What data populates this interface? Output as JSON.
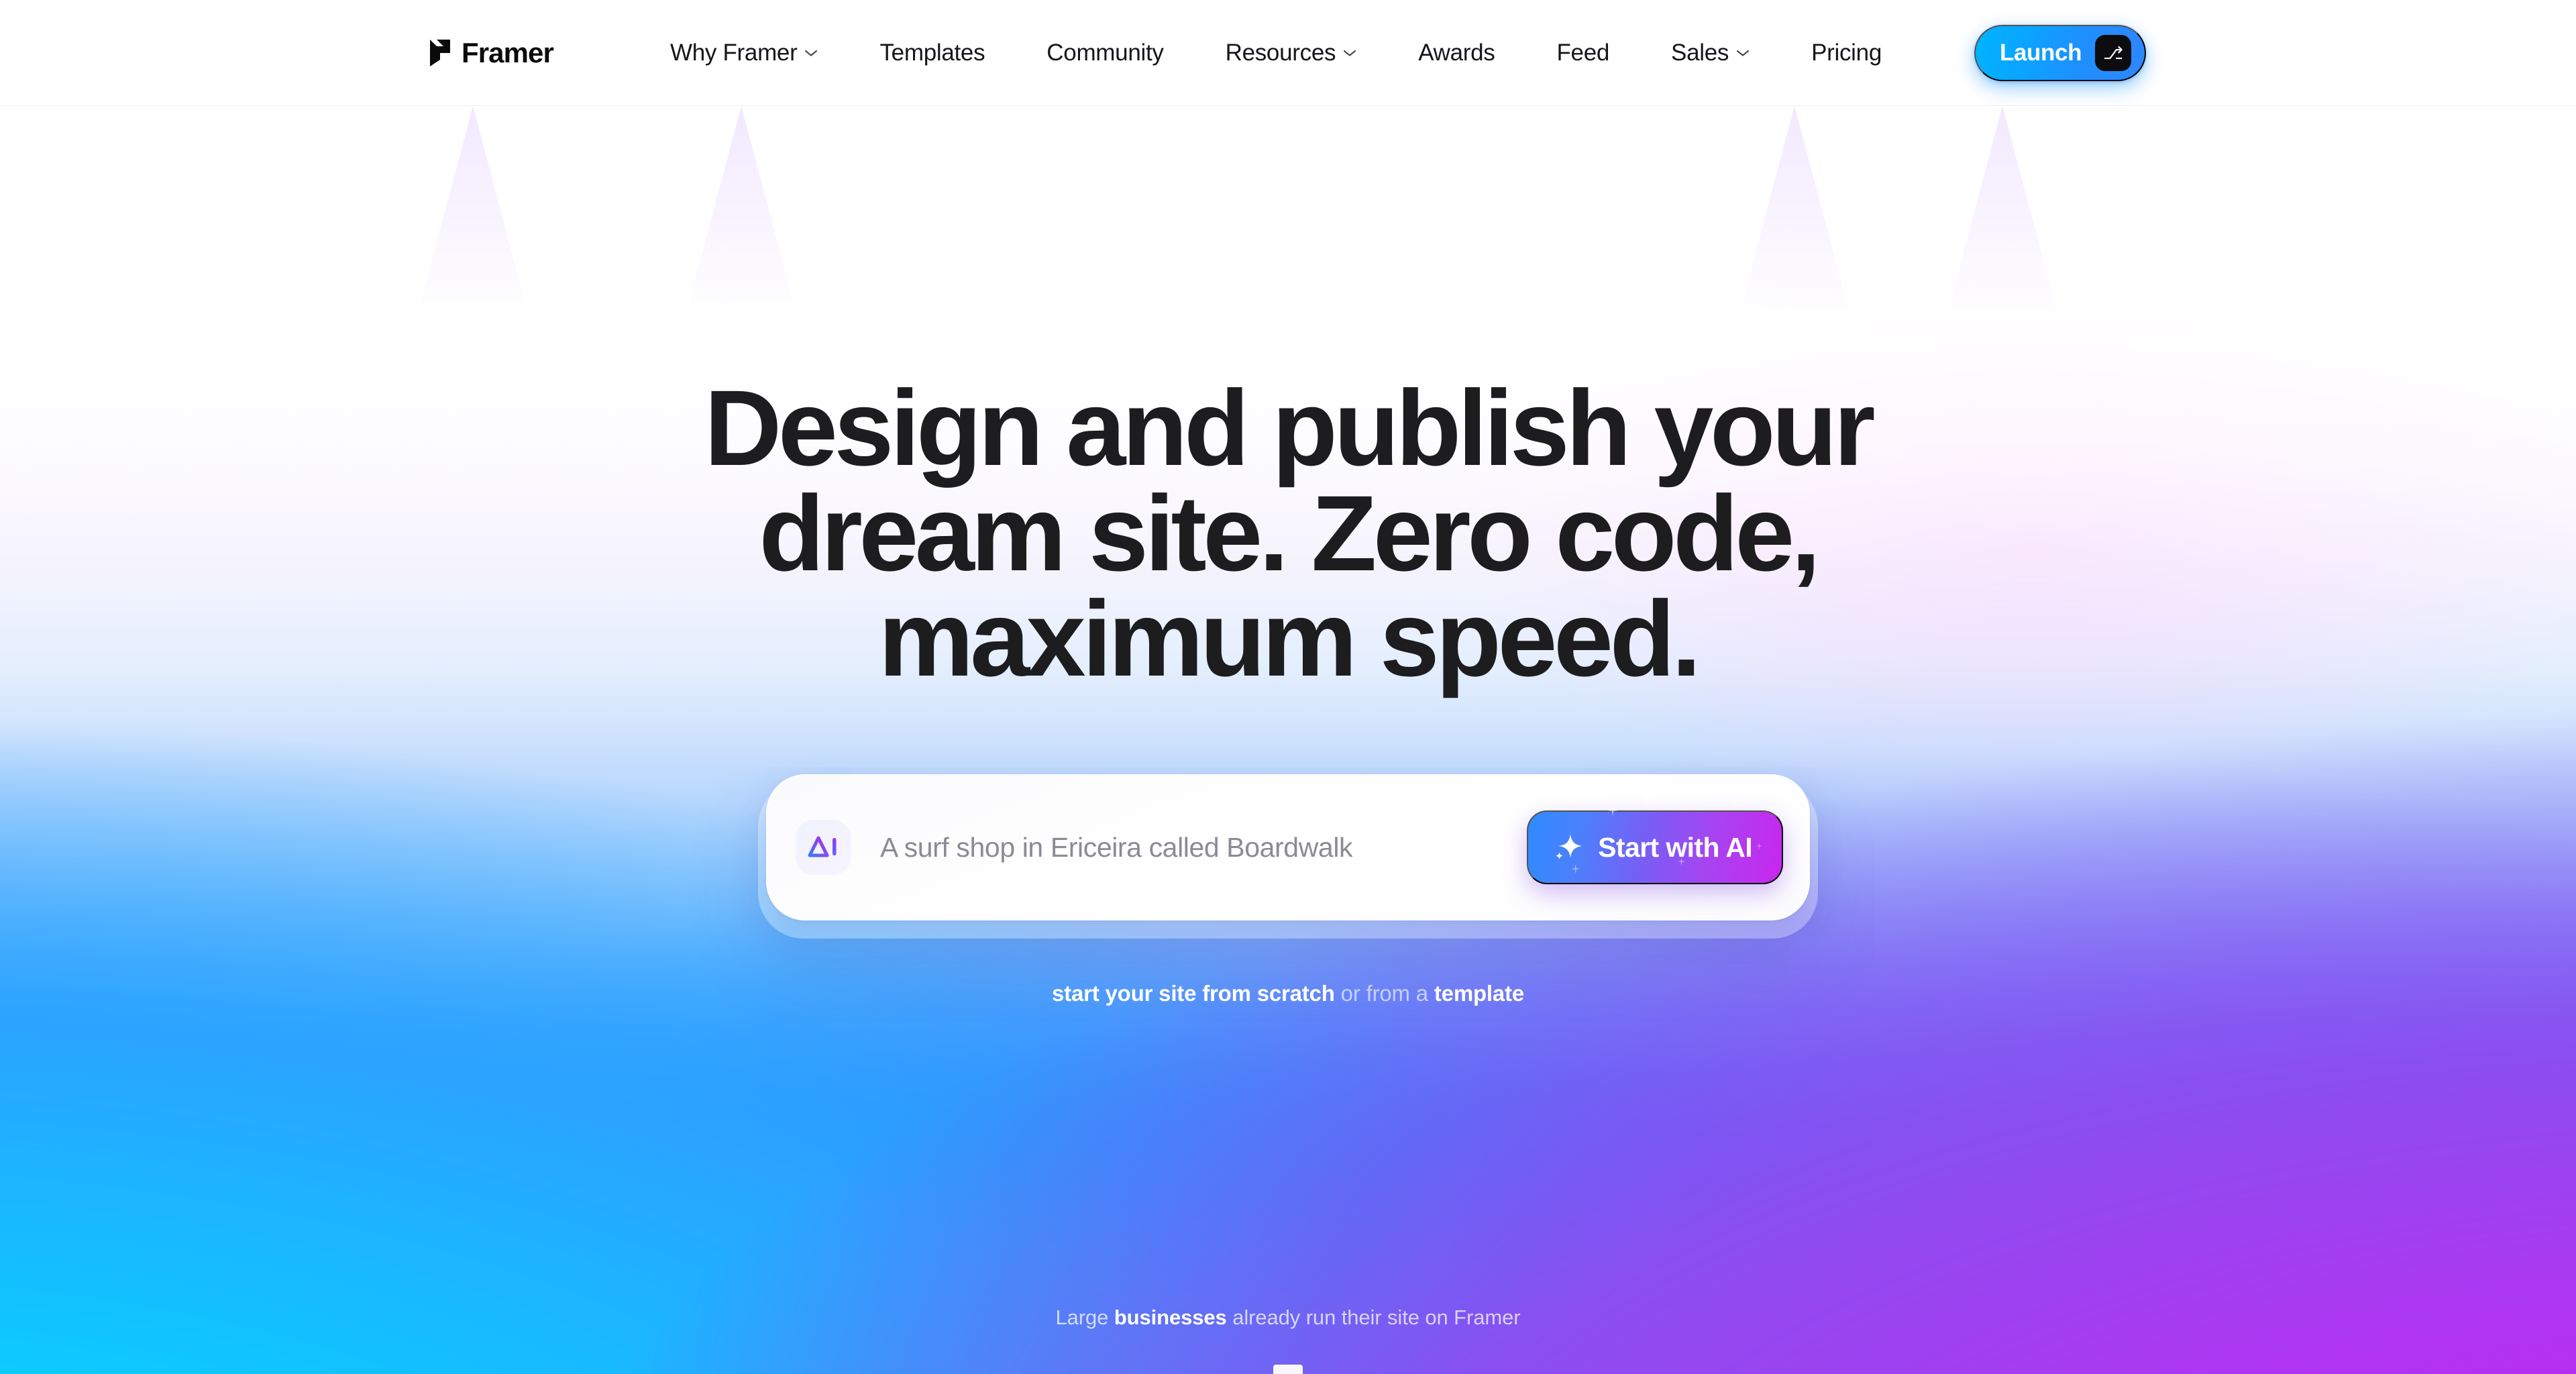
{
  "brand": {
    "name": "Framer",
    "logo_icon": "framer-logo-icon"
  },
  "nav": {
    "items": [
      {
        "label": "Why Framer",
        "has_dropdown": true,
        "icon": "chevron-down-icon"
      },
      {
        "label": "Templates",
        "has_dropdown": false,
        "icon": ""
      },
      {
        "label": "Community",
        "has_dropdown": false,
        "icon": ""
      },
      {
        "label": "Resources",
        "has_dropdown": true,
        "icon": "chevron-down-icon"
      },
      {
        "label": "Awards",
        "has_dropdown": false,
        "icon": ""
      },
      {
        "label": "Feed",
        "has_dropdown": false,
        "icon": ""
      },
      {
        "label": "Sales",
        "has_dropdown": true,
        "icon": "chevron-down-icon"
      },
      {
        "label": "Pricing",
        "has_dropdown": false,
        "icon": ""
      }
    ],
    "launch": {
      "label": "Launch",
      "shortcut_glyph": "⎇",
      "bg_color": "#00b4ff"
    }
  },
  "hero": {
    "headline_lines": [
      "Design and publish your",
      "dream site. Zero code,",
      "maximum speed."
    ],
    "prompt": {
      "ai_icon": "ai-triangle-icon",
      "placeholder": "A surf shop in Ericeira called Boardwalk",
      "value": "",
      "cta": {
        "label": "Start with AI",
        "icon": "sparkle-icon"
      }
    },
    "sub_line": {
      "link_1": "start your site from scratch",
      "middle": " or from a ",
      "link_2": "template"
    },
    "businesses_line": {
      "prefix": "Large ",
      "bold": "businesses",
      "suffix": " already run their site on Framer"
    }
  },
  "colors": {
    "accent_blue": "#00b4ff",
    "gradient_start": "#00e7ff",
    "gradient_mid": "#0a7bff",
    "gradient_end": "#d11bf5",
    "ai_button_from": "#2f8bff",
    "ai_button_to": "#c926ee",
    "headline_color": "#1d1d1f",
    "placeholder_color": "#8b8b94"
  }
}
